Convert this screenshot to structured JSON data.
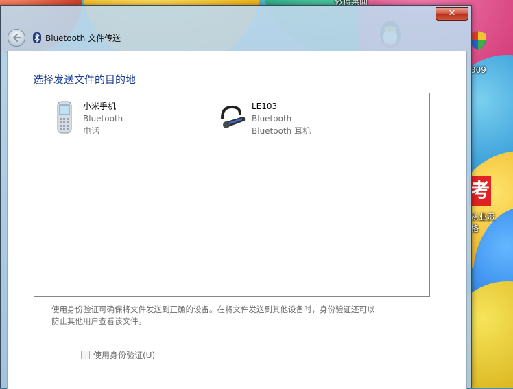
{
  "desktop": {
    "top_icon_label": "微博桌面",
    "right_icon_label_1": "309",
    "right_icon_label_2_line1": "从业资",
    "right_icon_label_2_line2": "格",
    "app_tile_char": "考"
  },
  "window": {
    "title": "Bluetooth 文件传送",
    "close_label": "✕",
    "heading": "选择发送文件的目的地",
    "devices": [
      {
        "name": "小米手机",
        "line2": "Bluetooth",
        "line3": "电话",
        "icon": "mobile-phone-icon"
      },
      {
        "name": "LE103",
        "line2": "Bluetooth",
        "line3": "Bluetooth 耳机",
        "icon": "headset-icon"
      }
    ],
    "note_line1": "使用身份验证可确保将文件发送到正确的设备。在将文件发送到其他设备时，身份验证还可以",
    "note_line2": "防止其他用户查看该文件。",
    "auth_checkbox_label": "使用身份验证(U)",
    "auth_checked": false
  },
  "colors": {
    "heading": "#1a3e93",
    "muted_text": "#6d6d6d",
    "close_button": "#c7432c"
  }
}
